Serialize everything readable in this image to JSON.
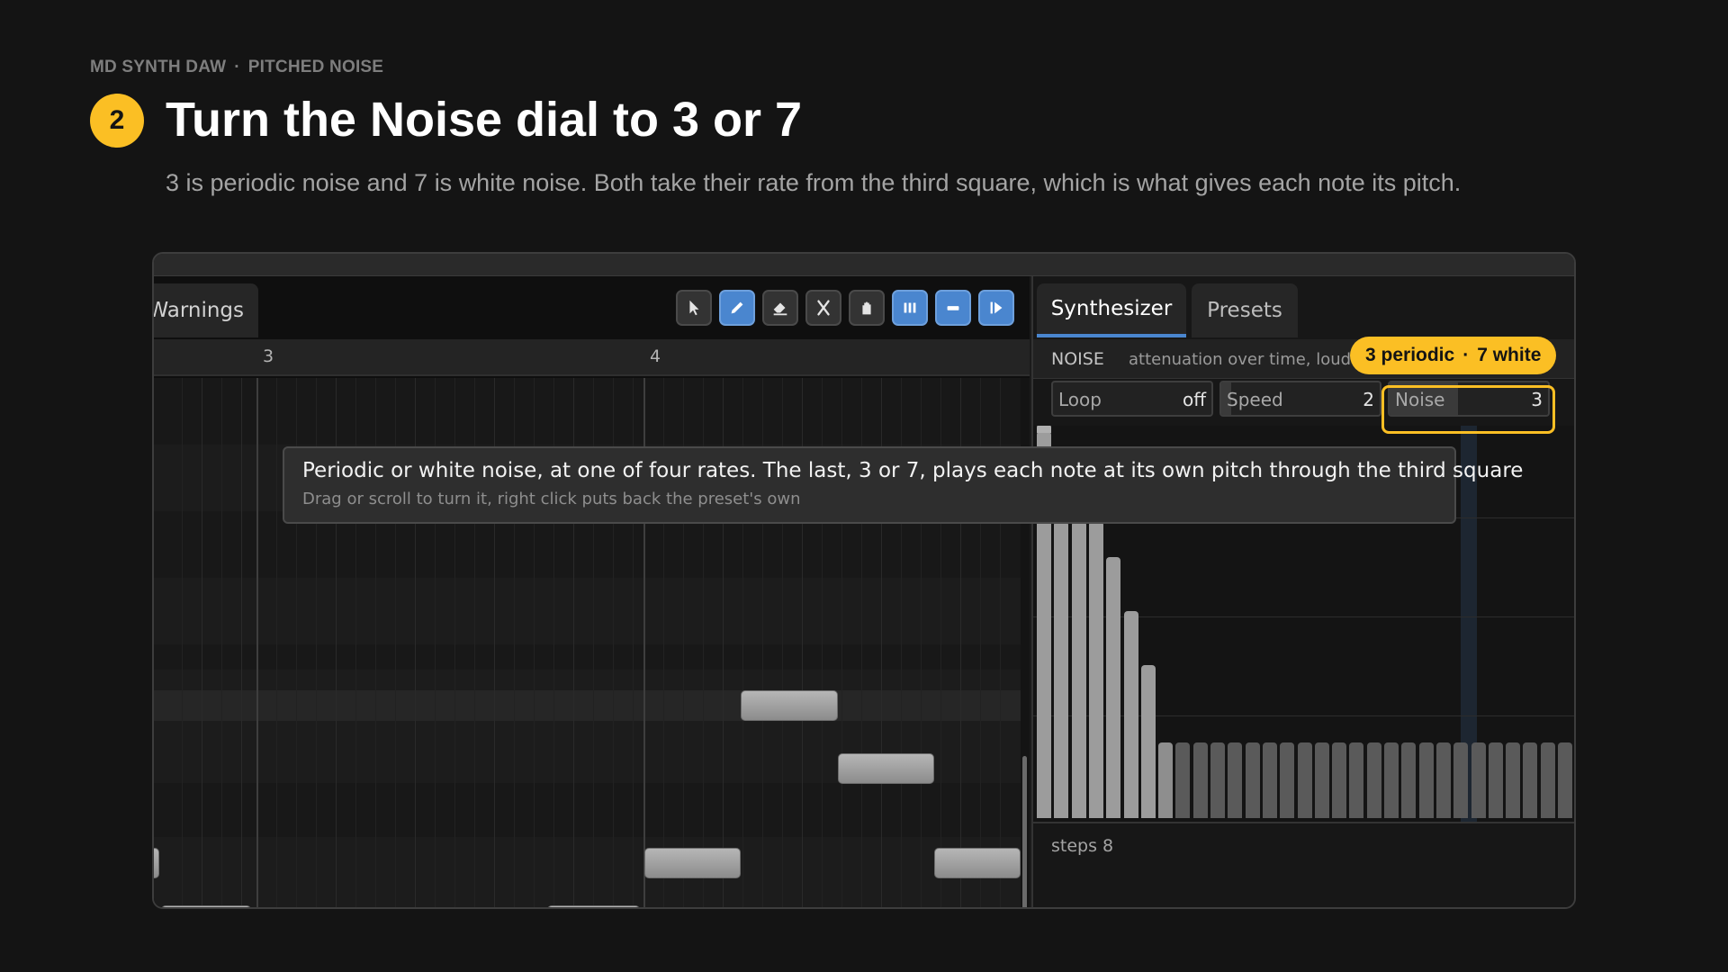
{
  "breadcrumb": {
    "app": "MD SYNTH DAW",
    "separator": "·",
    "section": "PITCHED NOISE"
  },
  "step": {
    "number": "2",
    "title": "Turn the Noise dial to 3 or 7",
    "subtitle": "3 is periodic noise and 7 is white noise. Both take their rate from the third square, which is what gives each note its pitch."
  },
  "editor": {
    "warnings_tab": "Warnings",
    "tools": [
      {
        "icon": "cursor-icon",
        "active": false
      },
      {
        "icon": "pencil-icon",
        "active": true
      },
      {
        "icon": "eraser-icon",
        "active": false
      },
      {
        "icon": "scissors-icon",
        "active": false
      },
      {
        "icon": "hand-icon",
        "active": false
      },
      {
        "icon": "bars-icon",
        "active": true
      },
      {
        "icon": "minus-icon",
        "active": true
      },
      {
        "icon": "play-from-icon",
        "active": true
      }
    ],
    "ruler": {
      "bar_3": "3",
      "bar_4": "4"
    }
  },
  "synth": {
    "tabs": {
      "synthesizer": "Synthesizer",
      "presets": "Presets"
    },
    "noise_section": {
      "label": "NOISE",
      "description": "attenuation over time, loudness"
    },
    "callout": {
      "periodic": "3 periodic",
      "separator": "·",
      "white": "7 white"
    },
    "controls": {
      "loop": {
        "label": "Loop",
        "value": "off"
      },
      "speed": {
        "label": "Speed",
        "value": "2",
        "level": 0.06
      },
      "noise": {
        "label": "Noise",
        "value": "3",
        "level": 0.43
      }
    },
    "steps_label": "steps 8"
  },
  "tooltip": {
    "main": "Periodic or white noise, at one of four rates. The last, 3 or 7, plays each note at its own pitch through the third square",
    "hint": "Drag or scroll to turn it, right click puts back the preset's own"
  },
  "colors": {
    "accent": "#fbbf24",
    "tool_active": "#4a86cf",
    "background": "#141414"
  }
}
